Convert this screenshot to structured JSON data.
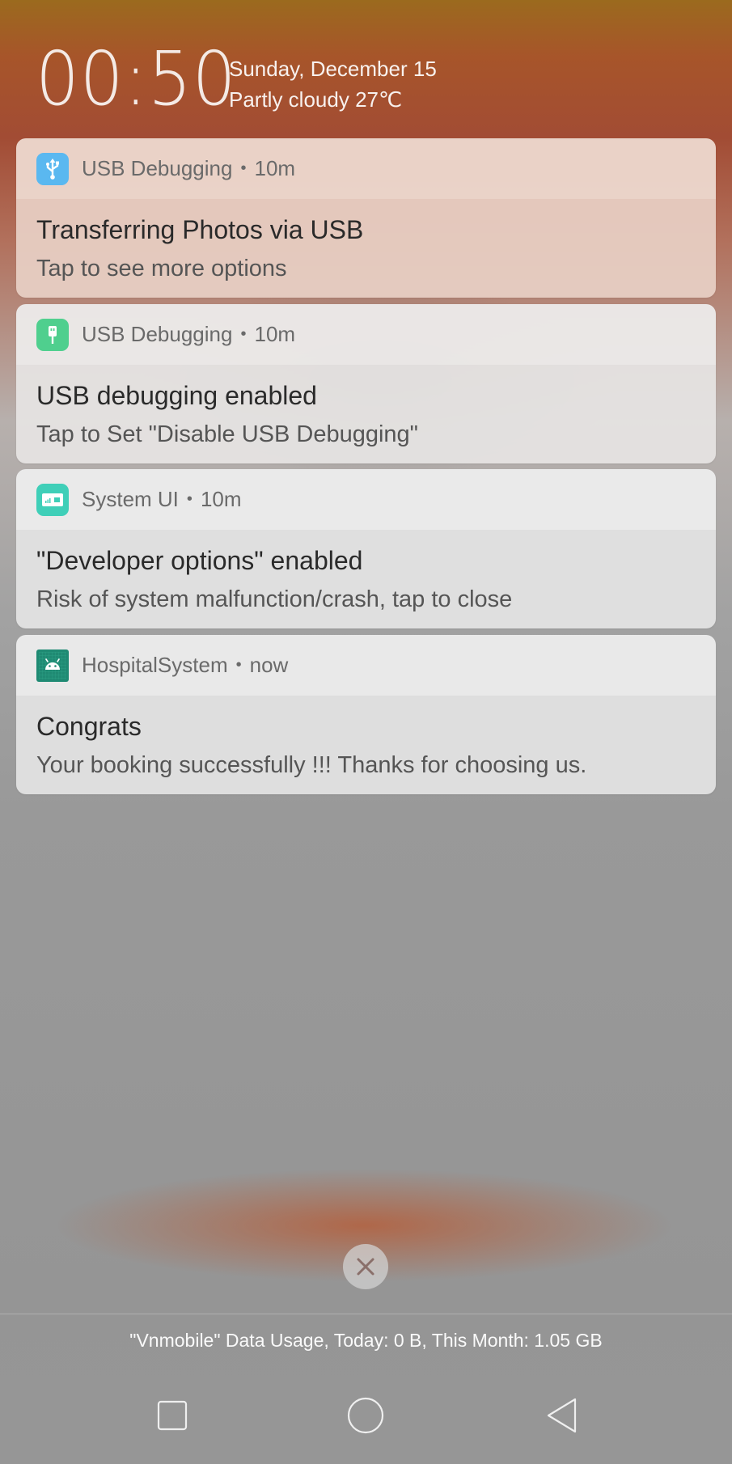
{
  "lockscreen": {
    "time": "00:50",
    "date": "Sunday, December 15",
    "weather": "Partly cloudy 27℃"
  },
  "notifications": [
    {
      "icon": "usb-icon",
      "icon_color": "#5ab8f0",
      "app": "USB Debugging",
      "separator": "•",
      "time": "10m",
      "title": "Transferring Photos via USB",
      "text": "Tap to see more options"
    },
    {
      "icon": "android-usb-icon",
      "icon_color": "#4fcf8e",
      "app": "USB Debugging",
      "separator": "•",
      "time": "10m",
      "title": "USB debugging enabled",
      "text": "Tap to Set \"Disable USB Debugging\""
    },
    {
      "icon": "developer-options-icon",
      "icon_color": "#3fcfb8",
      "app": "System UI",
      "separator": "•",
      "time": "10m",
      "title": "\"Developer options\" enabled",
      "text": "Risk of system malfunction/crash, tap to close"
    },
    {
      "icon": "android-app-icon",
      "icon_color": "#1f8a73",
      "app": "HospitalSystem",
      "separator": "•",
      "time": "now",
      "title": "Congrats",
      "text": "Your booking successfully !!! Thanks for choosing us."
    }
  ],
  "clear_all": {
    "icon": "close-icon"
  },
  "data_usage": "\"Vnmobile\" Data Usage, Today: 0 B, This Month: 1.05 GB",
  "navbar": {
    "recents_icon": "square-icon",
    "home_icon": "circle-icon",
    "back_icon": "triangle-back-icon"
  }
}
